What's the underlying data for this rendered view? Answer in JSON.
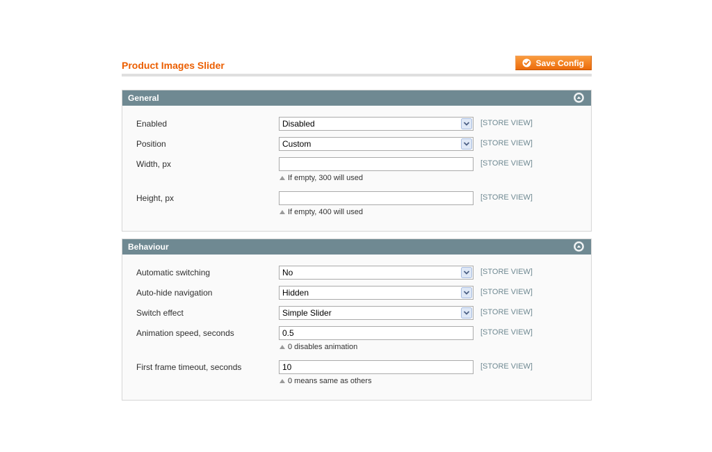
{
  "page": {
    "title": "Product Images Slider",
    "save_label": "Save Config"
  },
  "sections": [
    {
      "title": "General",
      "fields": [
        {
          "label": "Enabled",
          "type": "select",
          "value": "Disabled",
          "scope": "[STORE VIEW]"
        },
        {
          "label": "Position",
          "type": "select",
          "value": "Custom",
          "scope": "[STORE VIEW]"
        },
        {
          "label": "Width, px",
          "type": "text",
          "value": "",
          "scope": "[STORE VIEW]",
          "note": "If empty, 300 will used"
        },
        {
          "label": "Height, px",
          "type": "text",
          "value": "",
          "scope": "[STORE VIEW]",
          "note": "If empty, 400 will used"
        }
      ]
    },
    {
      "title": "Behaviour",
      "fields": [
        {
          "label": "Automatic switching",
          "type": "select",
          "value": "No",
          "scope": "[STORE VIEW]"
        },
        {
          "label": "Auto-hide navigation",
          "type": "select",
          "value": "Hidden",
          "scope": "[STORE VIEW]"
        },
        {
          "label": "Switch effect",
          "type": "select",
          "value": "Simple Slider",
          "scope": "[STORE VIEW]"
        },
        {
          "label": "Animation speed, seconds",
          "type": "text",
          "value": "0.5",
          "scope": "[STORE VIEW]",
          "note": "0 disables animation"
        },
        {
          "label": "First frame timeout, seconds",
          "type": "text",
          "value": "10",
          "scope": "[STORE VIEW]",
          "note": "0 means same as others"
        }
      ]
    }
  ],
  "colors": {
    "accent": "#eb5e00",
    "section_header": "#6f8992",
    "scope_text": "#6f8992"
  },
  "icons": {
    "save": "check-circle-icon",
    "collapse": "collapse-up-icon",
    "select": "chevron-down-icon",
    "note": "triangle-up-icon"
  }
}
